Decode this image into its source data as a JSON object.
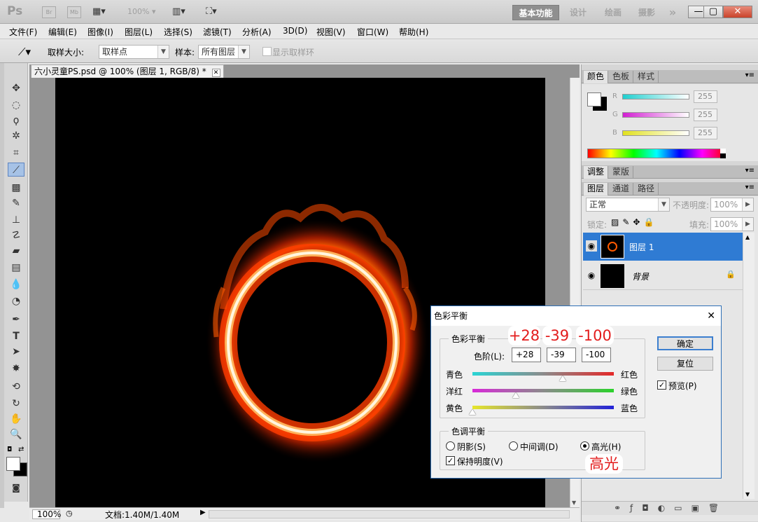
{
  "app": {
    "logo": "Ps",
    "bridge_label": "Br",
    "minibridge_label": "Mb",
    "zoom": "100%",
    "workspaces": [
      "基本功能",
      "设计",
      "绘画",
      "摄影"
    ],
    "more": "»",
    "window_buttons": {
      "min": "—",
      "restore": "▢",
      "close": "✕"
    }
  },
  "menu": [
    "文件(F)",
    "编辑(E)",
    "图像(I)",
    "图层(L)",
    "选择(S)",
    "滤镜(T)",
    "分析(A)",
    "3D(D)",
    "视图(V)",
    "窗口(W)",
    "帮助(H)"
  ],
  "options": {
    "sample_size_label": "取样大小:",
    "sample_size_value": "取样点",
    "sample_label": "样本:",
    "sample_value": "所有图层",
    "show_ring_label": "显示取样环"
  },
  "document": {
    "tab_title": "六小灵童PS.psd @ 100% (图层 1, RGB/8) *",
    "zoom": "100%",
    "doc_info": "文档:1.40M/1.40M"
  },
  "color_panel": {
    "tabs": [
      "颜色",
      "色板",
      "样式"
    ],
    "channels": [
      {
        "label": "R",
        "value": "255",
        "color": "#22d0d0"
      },
      {
        "label": "G",
        "value": "255",
        "color": "#d020d0"
      },
      {
        "label": "B",
        "value": "255",
        "color": "#e0e020"
      }
    ]
  },
  "adjust_panel": {
    "tabs": [
      "调整",
      "蒙版"
    ]
  },
  "layers_panel": {
    "tabs": [
      "图层",
      "通道",
      "路径"
    ],
    "blend_mode": "正常",
    "opacity_label": "不透明度:",
    "opacity_value": "100%",
    "lock_label": "锁定:",
    "fill_label": "填充:",
    "fill_value": "100%",
    "layers": [
      {
        "name": "图层 1",
        "selected": true
      },
      {
        "name": "背景",
        "selected": false
      }
    ]
  },
  "dialog": {
    "title": "色彩平衡",
    "close": "✕",
    "color_balance_legend": "色彩平衡",
    "levels_label": "色阶(L):",
    "levels": [
      "+28",
      "-39",
      "-100"
    ],
    "sliders": [
      {
        "left": "青色",
        "right": "红色",
        "value": 28
      },
      {
        "left": "洋红",
        "right": "绿色",
        "value": -39
      },
      {
        "left": "黄色",
        "right": "蓝色",
        "value": -100
      }
    ],
    "tone_legend": "色调平衡",
    "tones": [
      "阴影(S)",
      "中间调(D)",
      "高光(H)"
    ],
    "selected_tone": "高光(H)",
    "preserve_luminosity": "保持明度(V)",
    "ok": "确定",
    "reset": "复位",
    "preview": "预览(P)",
    "callouts": [
      "+28",
      "-39",
      "-100",
      "高光"
    ]
  }
}
